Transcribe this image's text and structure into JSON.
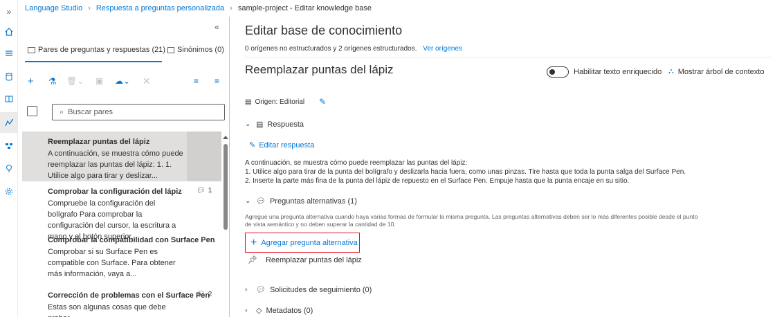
{
  "breadcrumb": {
    "items": [
      "Language Studio",
      "Respuesta a preguntas personalizada",
      "sample-project - Editar knowledge base"
    ],
    "expand_icon": "chevron-double-right-icon"
  },
  "rail": {
    "icons": [
      "home-icon",
      "list-icon",
      "database-icon",
      "book-icon",
      "settings-kb-icon",
      "deploy-icon",
      "lightbulb-icon",
      "gear-icon"
    ]
  },
  "left_panel": {
    "collapse_icon": "chevron-double-left-icon",
    "tabs": [
      {
        "label": "Pares de preguntas y respuestas (21)",
        "active": true
      },
      {
        "label": "Sinónimos (0)",
        "active": false
      }
    ],
    "toolbar": [
      "add-icon",
      "test-icon",
      "delete-icon",
      "save-icon",
      "sync-icon",
      "close-icon",
      "filter-icon",
      "sort-icon"
    ],
    "search_placeholder": "Buscar pares",
    "pairs": [
      {
        "title": "Reemplazar puntas del lápiz",
        "desc": "A continuación, se muestra cómo puede reemplazar las puntas del lápiz: 1. 1. Utilice algo para tirar y deslizar...",
        "badge": ""
      },
      {
        "title": "Comprobar la configuración del lápiz",
        "desc": "Compruebe la configuración del bolígrafo Para comprobar la configuración del cursor, la escritura a mano y el botón superior...",
        "badge": "1"
      },
      {
        "title": "Comprobar la compatibilidad con Surface Pen",
        "desc": "Comprobar si su Surface Pen es compatible con Surface. Para obtener más información, vaya a...",
        "badge": ""
      },
      {
        "title": "Corrección de problemas con el Surface Pen",
        "desc": "Estas son algunas cosas que debe probar",
        "badge": "2"
      }
    ]
  },
  "right_panel": {
    "title": "Editar base de conocimiento",
    "subtitle": "0 orígenes no estructurados y 2 orígenes estructurados.",
    "view_sources": "Ver orígenes",
    "pair_title": "Reemplazar puntas del lápiz",
    "rich_text_toggle": "Habilitar texto enriquecido",
    "context_tree": "Mostrar árbol de contexto",
    "origin": "Origen: Editorial",
    "answer_section": "Respuesta",
    "edit_answer": "Editar respuesta",
    "answer_lines": [
      "A continuación, se muestra cómo puede reemplazar las puntas del lápiz:",
      "1. Utilice algo para tirar de la punta del bolígrafo y deslizarla hacia fuera, como unas pinzas. Tire hasta que toda la punta salga del Surface Pen.",
      "2. Inserte la parte más fina de la punta del lápiz de repuesto en el Surface Pen. Empuje hasta que la punta encaje en su sitio."
    ],
    "alt_questions_section": "Preguntas alternativas (1)",
    "alt_helper": "Agregue una pregunta alternativa cuando haya varias formas de formular la misma pregunta. Las preguntas alternativas deben ser lo más diferentes posible desde el punto de vista semántico y no deben superar la cantidad de 10.",
    "add_alt_button": "Agregar pregunta alternativa",
    "alt_questions": [
      "Reemplazar puntas del lápiz"
    ],
    "followup_section": "Solicitudes de seguimiento (0)",
    "metadata_section": "Metadatos (0)"
  }
}
